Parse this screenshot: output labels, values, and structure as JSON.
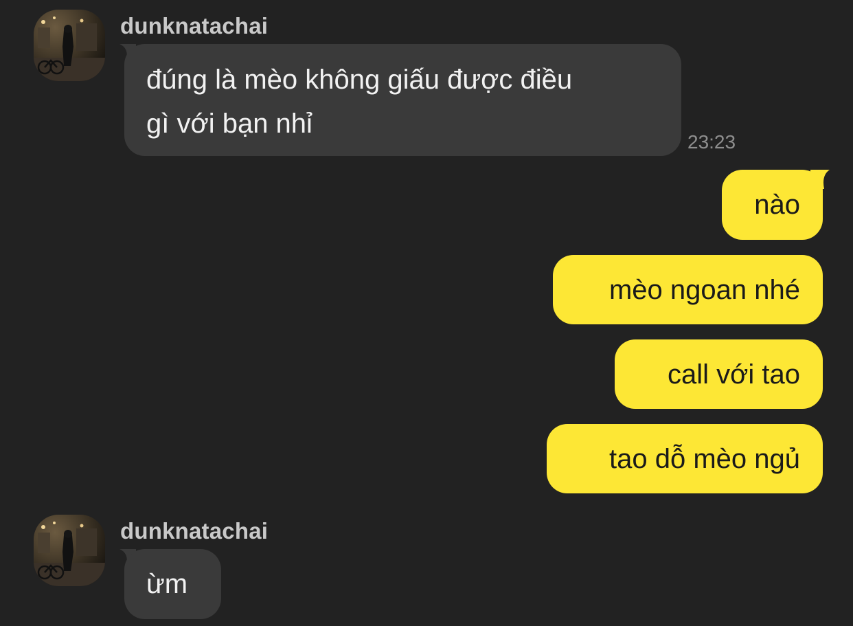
{
  "colors": {
    "background": "#222222",
    "incoming_bubble": "#3a3a3a",
    "outgoing_bubble": "#fde735",
    "sender_name": "#c9c9c9",
    "timestamp": "#8e8e8e"
  },
  "messages": [
    {
      "direction": "incoming",
      "sender": "dunknatachai",
      "avatar_icon": "profile-photo-icon",
      "lines": [
        "đúng là mèo không giấu được điều",
        "gì với bạn nhỉ"
      ],
      "time": "23:23"
    },
    {
      "direction": "outgoing",
      "text": "nào"
    },
    {
      "direction": "outgoing",
      "text": "mèo ngoan nhé"
    },
    {
      "direction": "outgoing",
      "text": "call với tao"
    },
    {
      "direction": "outgoing",
      "text": "tao dỗ mèo ngủ"
    },
    {
      "direction": "incoming",
      "sender": "dunknatachai",
      "avatar_icon": "profile-photo-icon",
      "lines": [
        "ừm"
      ]
    }
  ]
}
